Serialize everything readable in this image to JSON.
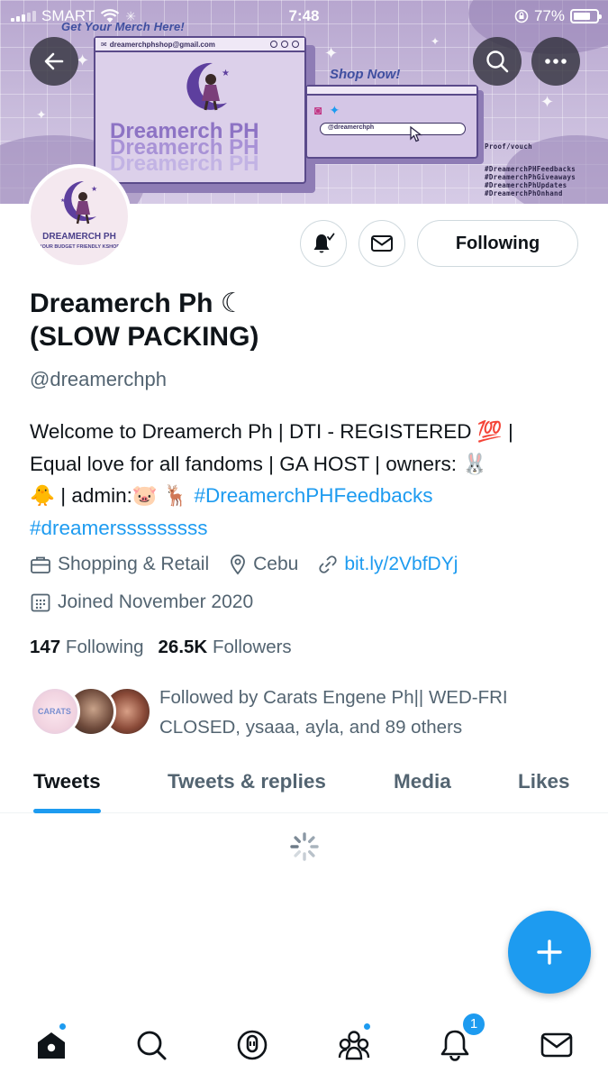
{
  "status_bar": {
    "carrier": "SMART",
    "time": "7:48",
    "battery": "77%",
    "battery_level": 0.77
  },
  "banner": {
    "headline": "Get Your Merch Here!",
    "email": "dreamerchphshop@gmail.com",
    "wordmark": "Dreamerch PH",
    "shop_now": "Shop Now!",
    "search_handle": "@dreamerchph",
    "proof_label": "Proof/vouch",
    "hashtags": [
      "#DreamerchPHFeedbacks",
      "#DreamerchPhGiveaways",
      "#DreamerchPhUpdates",
      "#DreamerchPhOnhand"
    ]
  },
  "avatar": {
    "brand": "DREAMERCH PH",
    "tagline": "YOUR BUDGET FRIENDLY KSHOP"
  },
  "actions": {
    "following_label": "Following"
  },
  "profile": {
    "name_line1": "Dreamerch Ph ☾",
    "name_line2": "(SLOW PACKING)",
    "handle": "@dreamerchph",
    "bio_line1": "Welcome to Dreamerch Ph | DTI - REGISTERED 💯 |",
    "bio_line2": "Equal love for all fandoms | GA HOST | owners: 🐰",
    "bio_line3_text": "🐥 | admin:🐷 🦌 ",
    "bio_line3_link": "#DreamerchPHFeedbacks",
    "bio_line4_link": "#dreamersssssssss",
    "category": "Shopping & Retail",
    "location": "Cebu",
    "url": "bit.ly/2VbfDYj",
    "joined": "Joined November 2020",
    "following_count": "147",
    "following_label": "Following",
    "followers_count": "26.5K",
    "followers_label": "Followers",
    "followed_by": "Followed by Carats Engene Ph|| WED-FRI CLOSED, ysaaa, ayla, and 89 others",
    "followed_by_line1": "Followed by Carats Engene Ph|| WED-FRI",
    "followed_by_line2": "CLOSED, ysaaa, ayla, and 89 others",
    "follower_avatar_text": "CARATS"
  },
  "tabs": [
    {
      "label": "Tweets",
      "active": true
    },
    {
      "label": "Tweets & replies",
      "active": false
    },
    {
      "label": "Media",
      "active": false
    },
    {
      "label": "Likes",
      "active": false
    }
  ],
  "bottom_nav": {
    "items": [
      "home-icon",
      "search-icon",
      "spaces-icon",
      "communities-icon",
      "notifications-icon",
      "messages-icon"
    ],
    "notification_count": "1"
  },
  "colors": {
    "accent": "#1d9bf0",
    "text_primary": "#0f1419",
    "text_secondary": "#536471",
    "banner_purple": "#b7a6cf"
  }
}
